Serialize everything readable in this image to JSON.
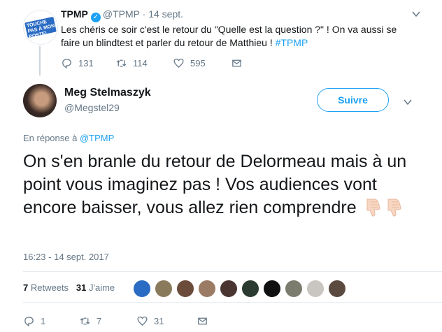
{
  "parent_tweet": {
    "name": "TPMP",
    "handle": "@TPMP",
    "separator": "·",
    "date": "14 sept.",
    "text_main": "Les chéris ce soir c'est le retour du \"Quelle est la question ?\" ! On va aussi se faire un blindtest et parler du retour de Matthieu ! ",
    "hashtag": "#TPMP",
    "avatar_text": "TOUCHE PAS À MON POSTE!",
    "replies": "131",
    "retweets": "114",
    "likes": "595"
  },
  "main_tweet": {
    "name": "Meg Stelmaszyk",
    "handle": "@Megstel29",
    "follow_label": "Suivre",
    "reply_prefix": "En réponse à ",
    "reply_handle": "@TPMP",
    "text": "On s'en branle du retour de Delormeau mais à un point vous imaginez pas ! Vos audiences vont encore baisser, vous allez rien comprendre",
    "timestamp": "16:23 - 14 sept. 2017",
    "retweets_count": "7",
    "retweets_label": "Retweets",
    "likes_count": "31",
    "likes_label": "J'aime",
    "replies": "1",
    "retweets": "7",
    "likes": "31"
  },
  "colors": {
    "accent": "#1da1f2",
    "muted": "#657786",
    "text": "#14171a"
  }
}
